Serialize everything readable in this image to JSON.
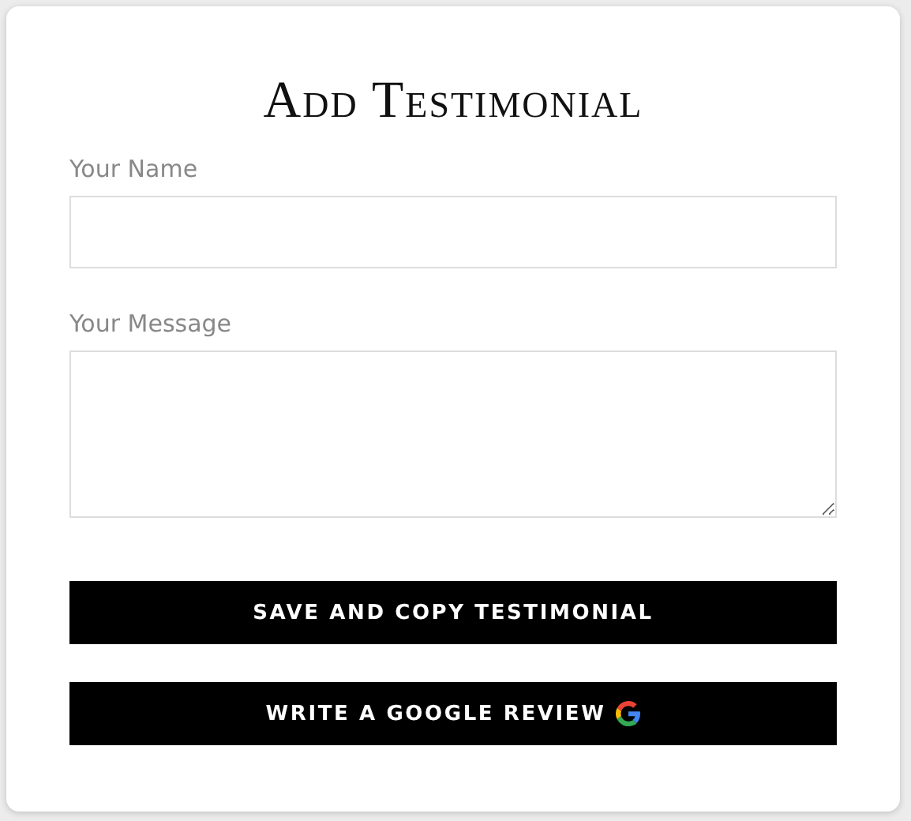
{
  "title": "Add Testimonial",
  "fields": [
    {
      "label": "Your Name",
      "kind": "input"
    },
    {
      "label": "Your Message",
      "kind": "textarea"
    }
  ],
  "buttons": [
    {
      "label": "SAVE AND COPY TESTIMONIAL",
      "icon": false
    },
    {
      "label": "WRITE A GOOGLE REVIEW",
      "icon": true
    }
  ]
}
